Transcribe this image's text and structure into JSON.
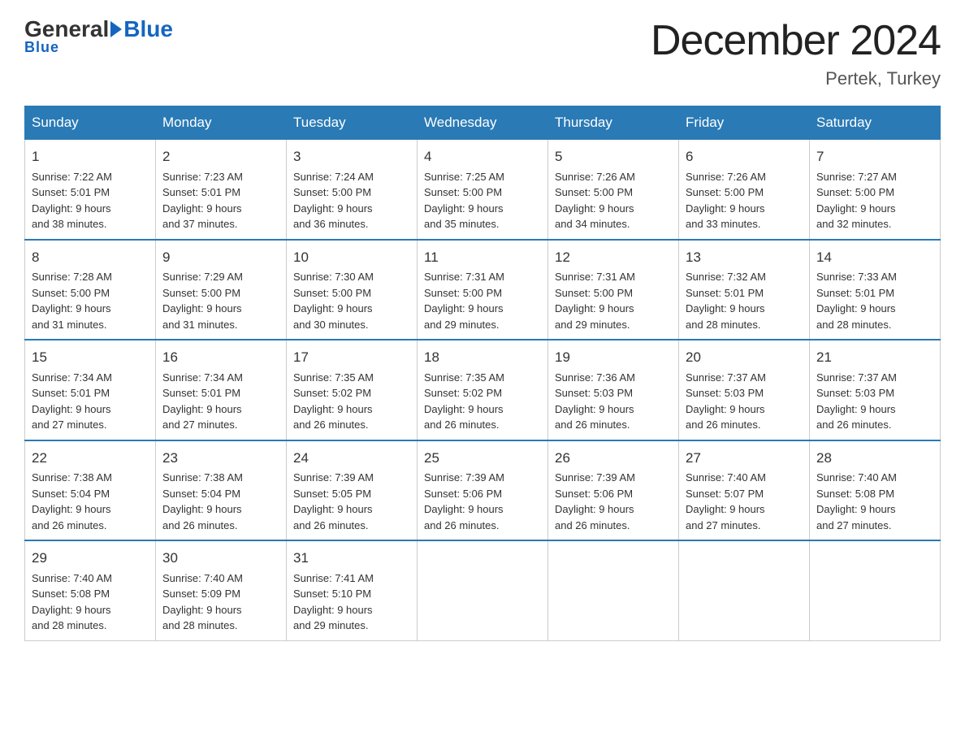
{
  "logo": {
    "general": "General",
    "blue": "Blue",
    "underline": "Blue"
  },
  "header": {
    "title": "December 2024",
    "subtitle": "Pertek, Turkey"
  },
  "days_of_week": [
    "Sunday",
    "Monday",
    "Tuesday",
    "Wednesday",
    "Thursday",
    "Friday",
    "Saturday"
  ],
  "weeks": [
    [
      {
        "day": "1",
        "info": "Sunrise: 7:22 AM\nSunset: 5:01 PM\nDaylight: 9 hours\nand 38 minutes."
      },
      {
        "day": "2",
        "info": "Sunrise: 7:23 AM\nSunset: 5:01 PM\nDaylight: 9 hours\nand 37 minutes."
      },
      {
        "day": "3",
        "info": "Sunrise: 7:24 AM\nSunset: 5:00 PM\nDaylight: 9 hours\nand 36 minutes."
      },
      {
        "day": "4",
        "info": "Sunrise: 7:25 AM\nSunset: 5:00 PM\nDaylight: 9 hours\nand 35 minutes."
      },
      {
        "day": "5",
        "info": "Sunrise: 7:26 AM\nSunset: 5:00 PM\nDaylight: 9 hours\nand 34 minutes."
      },
      {
        "day": "6",
        "info": "Sunrise: 7:26 AM\nSunset: 5:00 PM\nDaylight: 9 hours\nand 33 minutes."
      },
      {
        "day": "7",
        "info": "Sunrise: 7:27 AM\nSunset: 5:00 PM\nDaylight: 9 hours\nand 32 minutes."
      }
    ],
    [
      {
        "day": "8",
        "info": "Sunrise: 7:28 AM\nSunset: 5:00 PM\nDaylight: 9 hours\nand 31 minutes."
      },
      {
        "day": "9",
        "info": "Sunrise: 7:29 AM\nSunset: 5:00 PM\nDaylight: 9 hours\nand 31 minutes."
      },
      {
        "day": "10",
        "info": "Sunrise: 7:30 AM\nSunset: 5:00 PM\nDaylight: 9 hours\nand 30 minutes."
      },
      {
        "day": "11",
        "info": "Sunrise: 7:31 AM\nSunset: 5:00 PM\nDaylight: 9 hours\nand 29 minutes."
      },
      {
        "day": "12",
        "info": "Sunrise: 7:31 AM\nSunset: 5:00 PM\nDaylight: 9 hours\nand 29 minutes."
      },
      {
        "day": "13",
        "info": "Sunrise: 7:32 AM\nSunset: 5:01 PM\nDaylight: 9 hours\nand 28 minutes."
      },
      {
        "day": "14",
        "info": "Sunrise: 7:33 AM\nSunset: 5:01 PM\nDaylight: 9 hours\nand 28 minutes."
      }
    ],
    [
      {
        "day": "15",
        "info": "Sunrise: 7:34 AM\nSunset: 5:01 PM\nDaylight: 9 hours\nand 27 minutes."
      },
      {
        "day": "16",
        "info": "Sunrise: 7:34 AM\nSunset: 5:01 PM\nDaylight: 9 hours\nand 27 minutes."
      },
      {
        "day": "17",
        "info": "Sunrise: 7:35 AM\nSunset: 5:02 PM\nDaylight: 9 hours\nand 26 minutes."
      },
      {
        "day": "18",
        "info": "Sunrise: 7:35 AM\nSunset: 5:02 PM\nDaylight: 9 hours\nand 26 minutes."
      },
      {
        "day": "19",
        "info": "Sunrise: 7:36 AM\nSunset: 5:03 PM\nDaylight: 9 hours\nand 26 minutes."
      },
      {
        "day": "20",
        "info": "Sunrise: 7:37 AM\nSunset: 5:03 PM\nDaylight: 9 hours\nand 26 minutes."
      },
      {
        "day": "21",
        "info": "Sunrise: 7:37 AM\nSunset: 5:03 PM\nDaylight: 9 hours\nand 26 minutes."
      }
    ],
    [
      {
        "day": "22",
        "info": "Sunrise: 7:38 AM\nSunset: 5:04 PM\nDaylight: 9 hours\nand 26 minutes."
      },
      {
        "day": "23",
        "info": "Sunrise: 7:38 AM\nSunset: 5:04 PM\nDaylight: 9 hours\nand 26 minutes."
      },
      {
        "day": "24",
        "info": "Sunrise: 7:39 AM\nSunset: 5:05 PM\nDaylight: 9 hours\nand 26 minutes."
      },
      {
        "day": "25",
        "info": "Sunrise: 7:39 AM\nSunset: 5:06 PM\nDaylight: 9 hours\nand 26 minutes."
      },
      {
        "day": "26",
        "info": "Sunrise: 7:39 AM\nSunset: 5:06 PM\nDaylight: 9 hours\nand 26 minutes."
      },
      {
        "day": "27",
        "info": "Sunrise: 7:40 AM\nSunset: 5:07 PM\nDaylight: 9 hours\nand 27 minutes."
      },
      {
        "day": "28",
        "info": "Sunrise: 7:40 AM\nSunset: 5:08 PM\nDaylight: 9 hours\nand 27 minutes."
      }
    ],
    [
      {
        "day": "29",
        "info": "Sunrise: 7:40 AM\nSunset: 5:08 PM\nDaylight: 9 hours\nand 28 minutes."
      },
      {
        "day": "30",
        "info": "Sunrise: 7:40 AM\nSunset: 5:09 PM\nDaylight: 9 hours\nand 28 minutes."
      },
      {
        "day": "31",
        "info": "Sunrise: 7:41 AM\nSunset: 5:10 PM\nDaylight: 9 hours\nand 29 minutes."
      },
      {
        "day": "",
        "info": ""
      },
      {
        "day": "",
        "info": ""
      },
      {
        "day": "",
        "info": ""
      },
      {
        "day": "",
        "info": ""
      }
    ]
  ]
}
